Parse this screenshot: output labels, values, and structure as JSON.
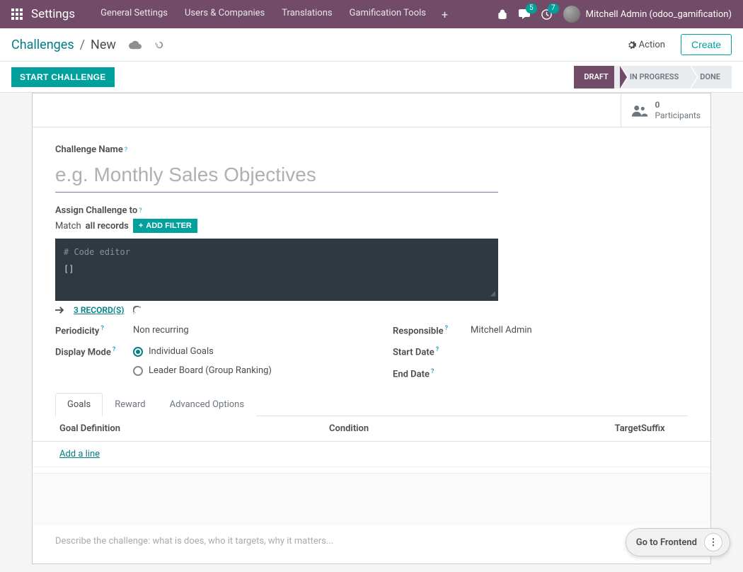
{
  "brand": "Settings",
  "nav": {
    "items": [
      "General Settings",
      "Users & Companies",
      "Translations",
      "Gamification Tools"
    ],
    "messages_badge": "5",
    "activities_badge": "7",
    "user": "Mitchell Admin (odoo_gamification)"
  },
  "breadcrumb": {
    "root": "Challenges",
    "current": "New"
  },
  "controls": {
    "action": "Action",
    "create": "Create"
  },
  "statusbar": {
    "start": "START CHALLENGE",
    "steps": [
      "DRAFT",
      "IN PROGRESS",
      "DONE"
    ],
    "active_index": 0
  },
  "stat": {
    "count": "0",
    "label": "Participants"
  },
  "form": {
    "name_label": "Challenge Name",
    "name_placeholder": "e.g. Monthly Sales Objectives",
    "assign_label": "Assign Challenge to",
    "match_pre": "Match",
    "match_bold": "all records",
    "add_filter": "ADD FILTER",
    "code_comment": "# Code editor",
    "code_value": "[]",
    "records_link": "3 RECORD(S)",
    "periodicity_label": "Periodicity",
    "periodicity_value": "Non recurring",
    "display_mode_label": "Display Mode",
    "display_mode_options": [
      "Individual Goals",
      "Leader Board (Group Ranking)"
    ],
    "responsible_label": "Responsible",
    "responsible_value": "Mitchell Admin",
    "start_date_label": "Start Date",
    "end_date_label": "End Date"
  },
  "tabs": [
    "Goals",
    "Reward",
    "Advanced Options"
  ],
  "goals_table": {
    "headers": [
      "Goal Definition",
      "Condition",
      "Target",
      "Suffix"
    ],
    "add_line": "Add a line"
  },
  "description_placeholder": "Describe the challenge: what is does, who it targets, why it matters...",
  "floating": "Go to Frontend"
}
